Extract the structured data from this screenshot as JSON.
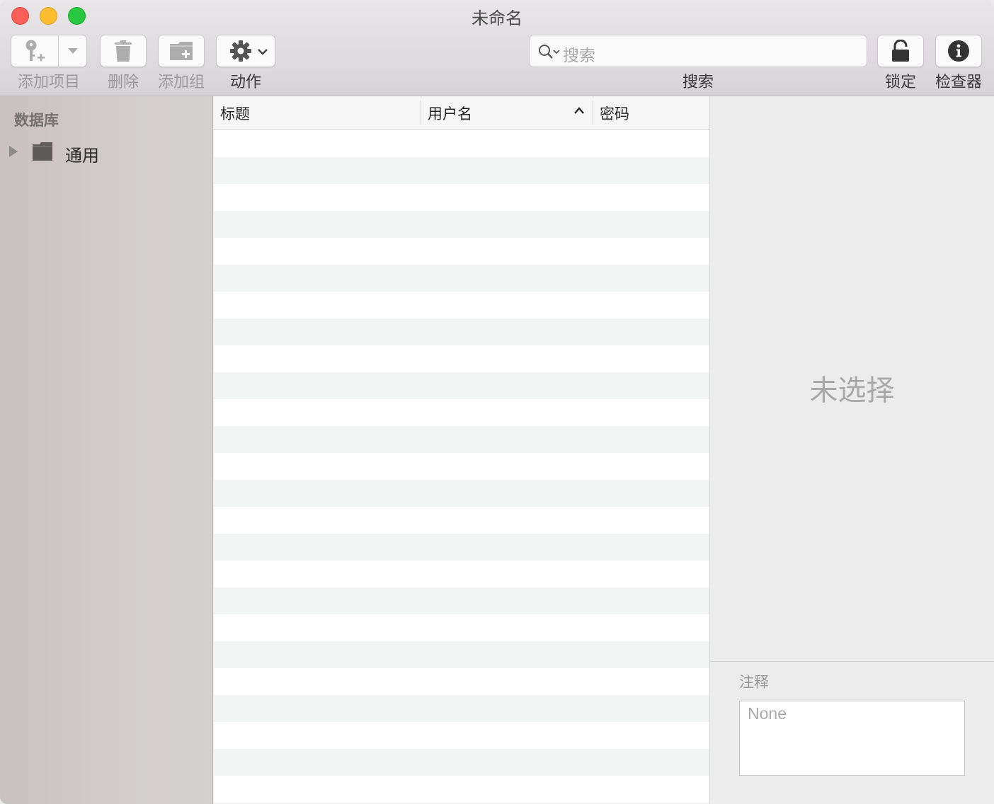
{
  "window": {
    "title": "未命名"
  },
  "toolbar": {
    "add_item_label": "添加项目",
    "delete_label": "删除",
    "add_group_label": "添加组",
    "action_label": "动作",
    "search_label": "搜索",
    "search_placeholder": "搜索",
    "lock_label": "锁定",
    "inspector_label": "检查器"
  },
  "sidebar": {
    "header": "数据库",
    "items": [
      {
        "label": "通用",
        "icon": "folder-icon"
      }
    ]
  },
  "table": {
    "columns": [
      "标题",
      "用户名",
      "密码"
    ],
    "sorted_column": "用户名",
    "sort_direction": "ascending",
    "rows": []
  },
  "inspector": {
    "empty_text": "未选择",
    "notes_label": "注释",
    "notes_placeholder": "None"
  },
  "colors": {
    "close": "#fe5f57",
    "minimize": "#febc2e",
    "maximize": "#28c840",
    "row_alt": "#f3f4f4"
  }
}
